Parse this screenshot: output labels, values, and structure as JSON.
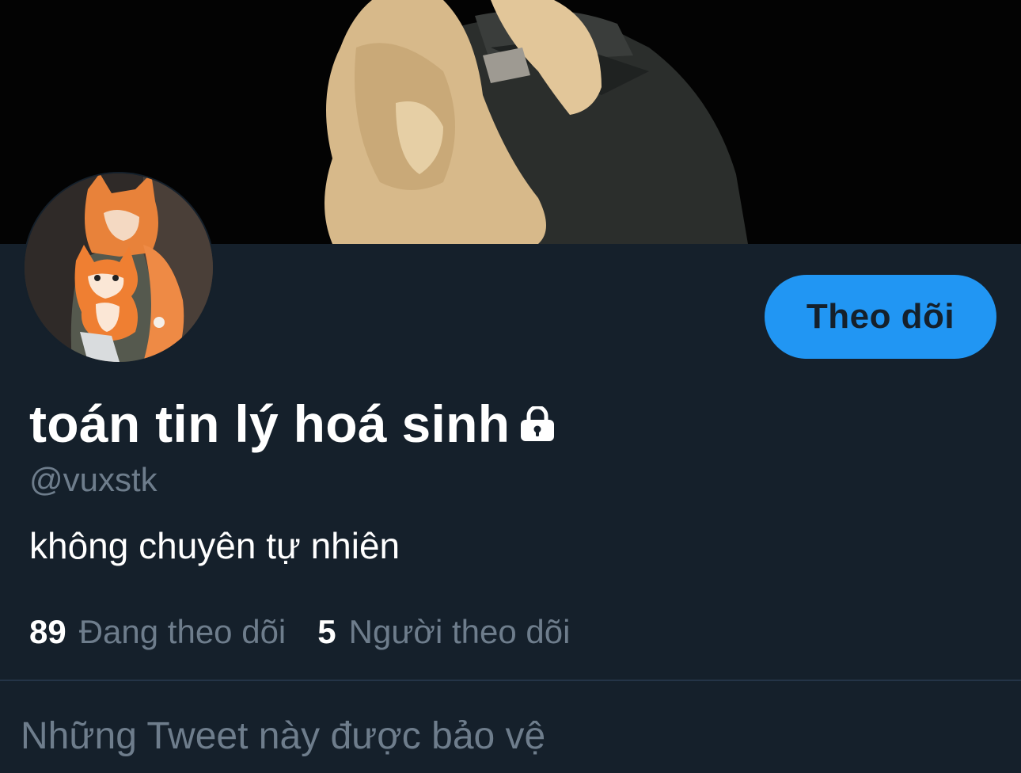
{
  "profile": {
    "display_name": "toán tin lý hoá sinh",
    "handle": "@vuxstk",
    "bio": "không chuyên tự nhiên",
    "follow_button_label": "Theo dõi",
    "protected_icon": "lock-icon"
  },
  "stats": {
    "following_count": "89",
    "following_label": "Đang theo dõi",
    "followers_count": "5",
    "followers_label": "Người theo dõi"
  },
  "timeline": {
    "protected_message": "Những Tweet này được bảo vệ"
  },
  "colors": {
    "background": "#15202b",
    "accent": "#2196f3",
    "secondary_text": "#6e7d8c",
    "primary_text": "#ffffff",
    "divider": "#243447"
  }
}
